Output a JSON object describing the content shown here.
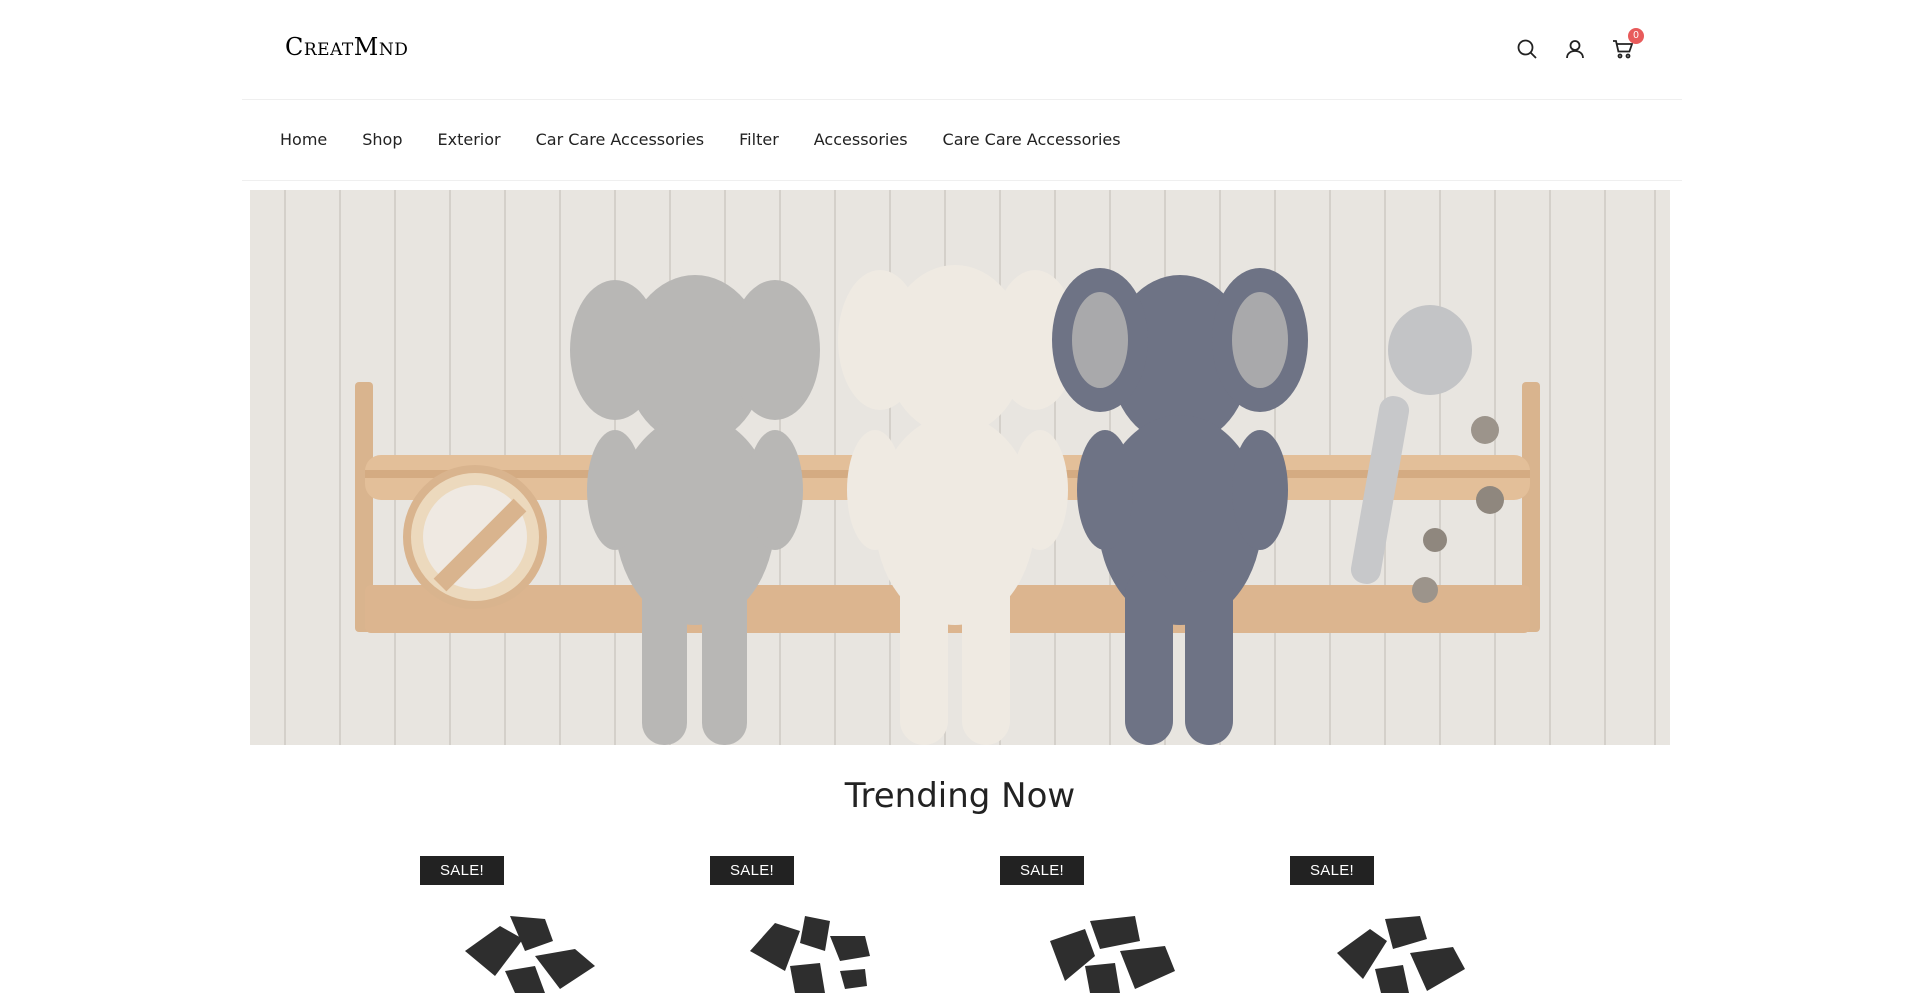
{
  "header": {
    "logo_text": "CreatMnd",
    "icons": {
      "search": "search-icon",
      "account": "user-icon",
      "cart": "cart-icon"
    },
    "cart_count": "0"
  },
  "nav": {
    "items": [
      {
        "label": "Home"
      },
      {
        "label": "Shop"
      },
      {
        "label": "Exterior"
      },
      {
        "label": "Car Care Accessories"
      },
      {
        "label": "Filter"
      },
      {
        "label": "Accessories"
      },
      {
        "label": "Care Care Accessories"
      }
    ]
  },
  "hero": {
    "image": "plush elephants on wooden shelf"
  },
  "trending": {
    "title": "Trending Now",
    "products": [
      {
        "badge": "SALE!",
        "image": "car floor mats"
      },
      {
        "badge": "SALE!",
        "image": "car floor mats"
      },
      {
        "badge": "SALE!",
        "image": "car floor mats"
      },
      {
        "badge": "SALE!",
        "image": "car floor mats"
      }
    ]
  },
  "colors": {
    "badge_bg": "#222222",
    "cart_count_bg": "#e85b5b",
    "text": "#222222"
  }
}
